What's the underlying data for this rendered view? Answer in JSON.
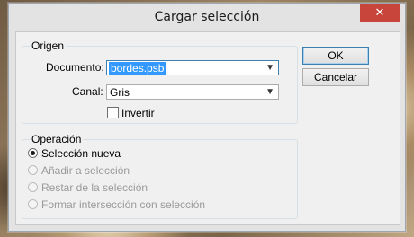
{
  "dialog": {
    "title": "Cargar selección",
    "close_glyph": "✕"
  },
  "origen": {
    "legend": "Origen",
    "documento_label": "Documento:",
    "documento_value": "bordes.psb",
    "canal_label": "Canal:",
    "canal_value": "Gris",
    "invertir_label": "Invertir",
    "invertir_checked": false
  },
  "operacion": {
    "legend": "Operación",
    "options": [
      {
        "label": "Selección nueva",
        "selected": true,
        "enabled": true
      },
      {
        "label": "Añadir a selección",
        "selected": false,
        "enabled": false
      },
      {
        "label": "Restar de la selección",
        "selected": false,
        "enabled": false
      },
      {
        "label": "Formar intersección con selección",
        "selected": false,
        "enabled": false
      }
    ]
  },
  "buttons": {
    "ok": "OK",
    "cancel": "Cancelar"
  },
  "icons": {
    "dropdown": "chevron-down-icon",
    "close": "close-icon"
  },
  "colors": {
    "close_button": "#c7453a",
    "focus_highlight": "#3399ff"
  }
}
